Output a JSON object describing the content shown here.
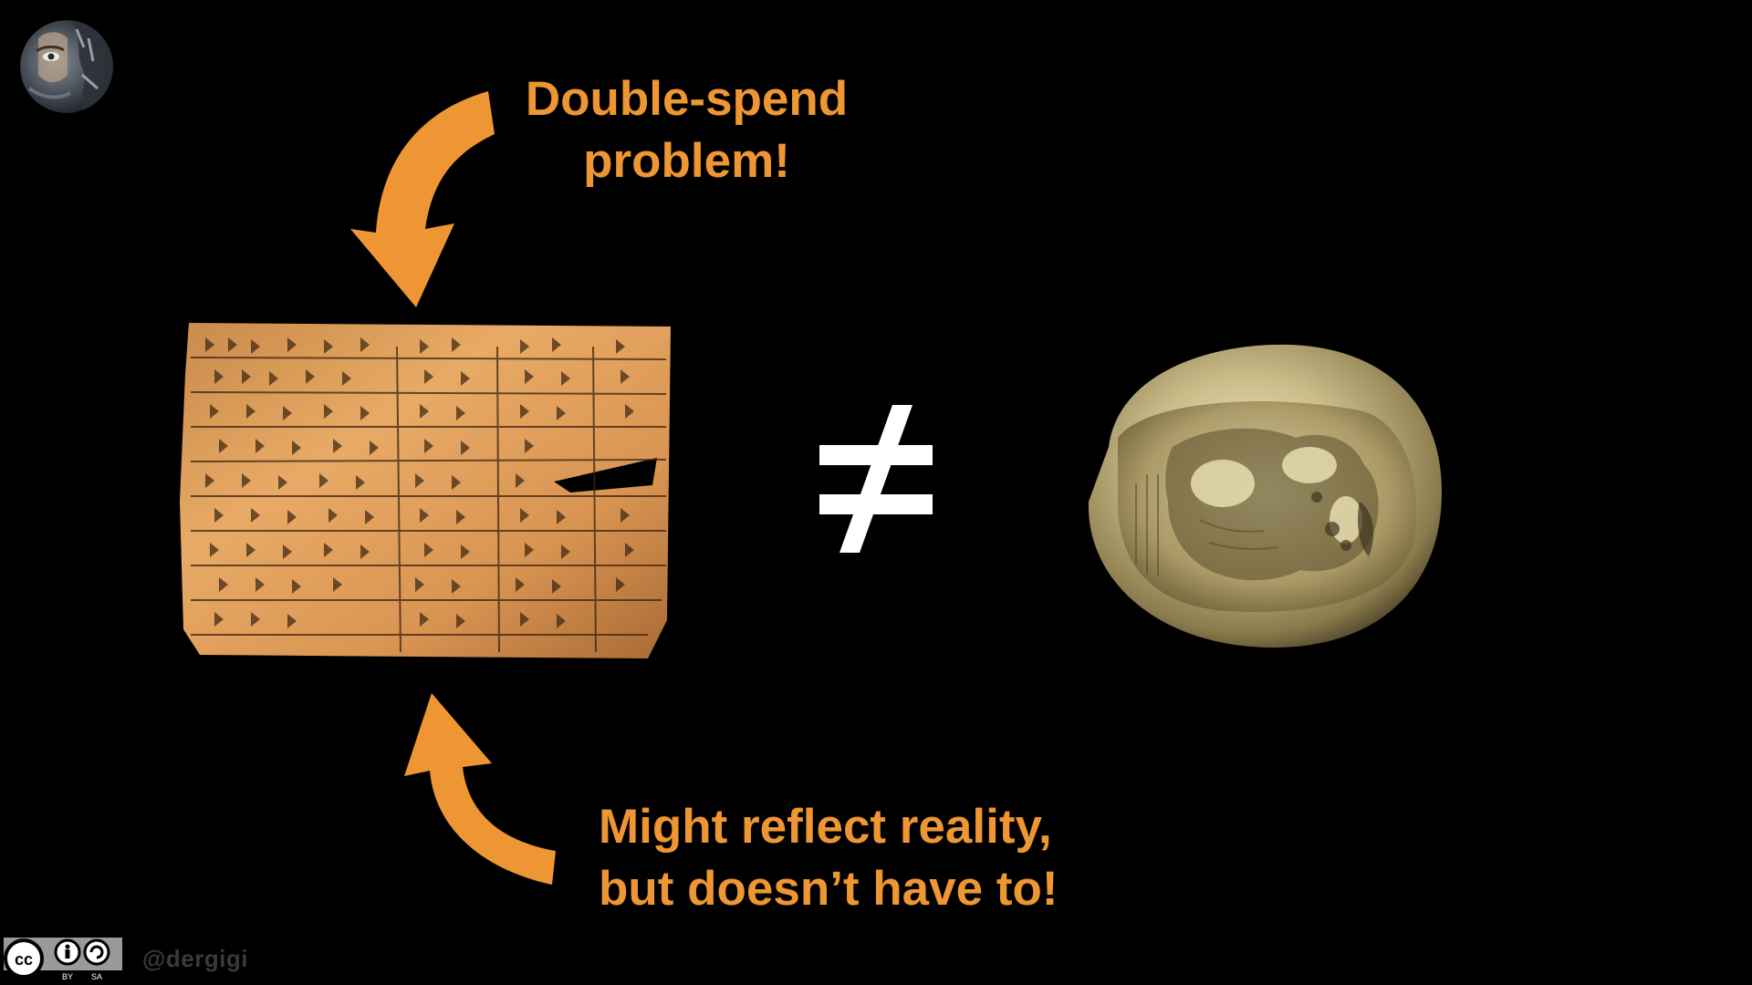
{
  "slide": {
    "background": "#000000",
    "accent_color": "#EE9633"
  },
  "avatar": {
    "icon": "portrait-avatar-icon"
  },
  "callout_top": {
    "lines": [
      "Double-spend",
      "problem!"
    ]
  },
  "callout_bottom": {
    "lines": [
      "Might reflect reality,",
      "but doesn’t have to!"
    ]
  },
  "symbol": {
    "icon": "not-equal-sign-icon"
  },
  "images": {
    "left": "cuneiform-tablet-image",
    "right": "lion-head-coin-image"
  },
  "footer": {
    "license_labels": [
      "BY",
      "SA"
    ],
    "license_icon": "creative-commons-by-sa-icon",
    "handle": "@dergigi"
  }
}
